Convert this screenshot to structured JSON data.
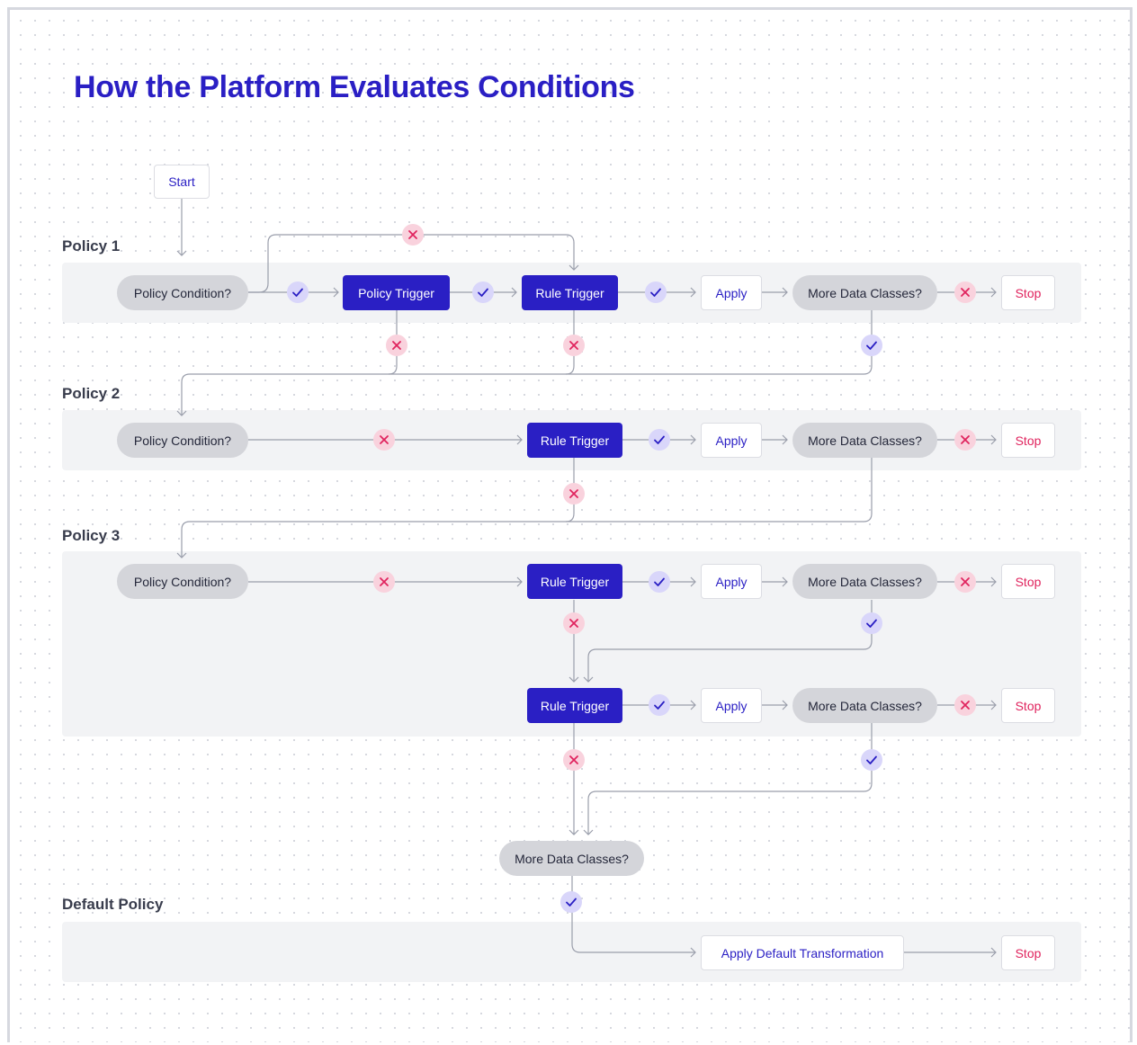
{
  "title": "How the Platform Evaluates Conditions",
  "start_label": "Start",
  "sections": {
    "policy1": "Policy 1",
    "policy2": "Policy 2",
    "policy3": "Policy 3",
    "default": "Default Policy"
  },
  "nodes": {
    "policy_condition": "Policy Condition?",
    "policy_trigger": "Policy Trigger",
    "rule_trigger": "Rule Trigger",
    "apply": "Apply",
    "more_data_classes": "More Data Classes?",
    "stop": "Stop",
    "apply_default": "Apply Default Transformation"
  },
  "badges": {
    "yes_icon": "check-icon",
    "no_icon": "cross-icon"
  },
  "colors": {
    "accent": "#2a1fc4",
    "stop_red": "#e0245e",
    "yes_bg": "#d9d6fa",
    "no_bg": "#f9d2dd",
    "pill_bg": "#d4d5da",
    "band_bg": "#f2f3f5",
    "line": "#9a9eab"
  }
}
